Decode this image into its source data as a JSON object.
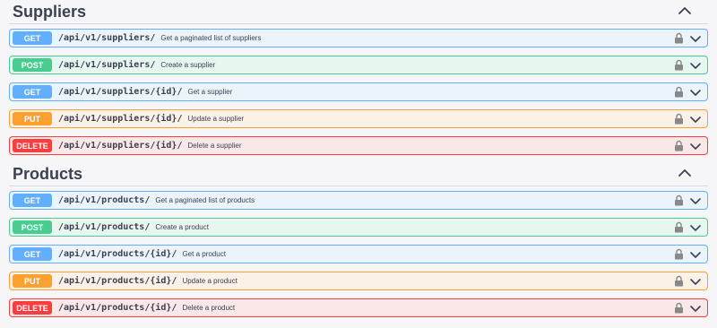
{
  "sections": [
    {
      "title": "Suppliers",
      "operations": [
        {
          "method": "GET",
          "path": "/api/v1/suppliers/",
          "summary": "Get a paginated list of suppliers"
        },
        {
          "method": "POST",
          "path": "/api/v1/suppliers/",
          "summary": "Create a supplier"
        },
        {
          "method": "GET",
          "path": "/api/v1/suppliers/{id}/",
          "summary": "Get a supplier"
        },
        {
          "method": "PUT",
          "path": "/api/v1/suppliers/{id}/",
          "summary": "Update a supplier"
        },
        {
          "method": "DELETE",
          "path": "/api/v1/suppliers/{id}/",
          "summary": "Delete a supplier"
        }
      ]
    },
    {
      "title": "Products",
      "operations": [
        {
          "method": "GET",
          "path": "/api/v1/products/",
          "summary": "Get a paginated list of products"
        },
        {
          "method": "POST",
          "path": "/api/v1/products/",
          "summary": "Create a product"
        },
        {
          "method": "GET",
          "path": "/api/v1/products/{id}/",
          "summary": "Get a product"
        },
        {
          "method": "PUT",
          "path": "/api/v1/products/{id}/",
          "summary": "Update a product"
        },
        {
          "method": "DELETE",
          "path": "/api/v1/products/{id}/",
          "summary": "Delete a product"
        }
      ]
    }
  ],
  "colors": {
    "get": "#61affe",
    "post": "#49cc90",
    "put": "#fca130",
    "delete": "#f93e3e"
  },
  "icons": {
    "section_toggle": "chevron-up-icon",
    "operation_lock": "lock-icon",
    "operation_expand": "chevron-down-icon"
  }
}
